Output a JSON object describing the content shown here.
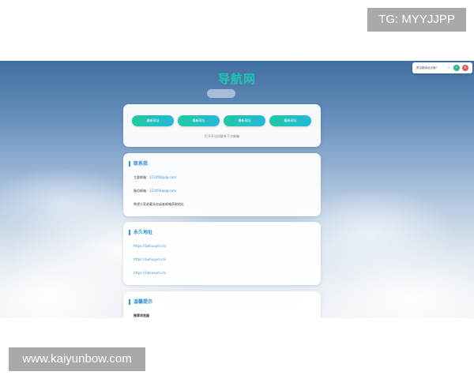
{
  "overlays": {
    "tg_label": "TG: MYYJJPP",
    "site_watermark": "www.kaiyunbow.com"
  },
  "site": {
    "title": "导航网"
  },
  "nav": {
    "buttons": [
      "最新网址",
      "最新网址",
      "最新网址",
      "最新网址"
    ],
    "note": "打不开访问联系下方邮箱"
  },
  "contact": {
    "heading": "联系我",
    "rows": [
      {
        "label": "主要邮箱：",
        "value": "123456@qq.com"
      },
      {
        "label": "备用邮箱：",
        "value": "123456@qq.com"
      }
    ],
    "note": "希望大家收藏本站或者邮箱获取地址"
  },
  "address": {
    "heading": "永久地址",
    "links": [
      "https://1whuaym.cn/",
      "https://1whuaym.cn/",
      "https://1whuaym.cn/"
    ]
  },
  "tips": {
    "heading": "温馨提示",
    "first_line": "推荐浏览器"
  },
  "translate_panel": {
    "text": "是否翻译此页面？",
    "ok_symbol": "✓",
    "close_symbol": "×"
  },
  "colors": {
    "accent": "#1fc6b0",
    "heading_blue": "#2f8fd0",
    "link_blue": "#3b8fd6",
    "button_gradient_start": "#1fc9a3",
    "button_gradient_end": "#27b7d9"
  }
}
